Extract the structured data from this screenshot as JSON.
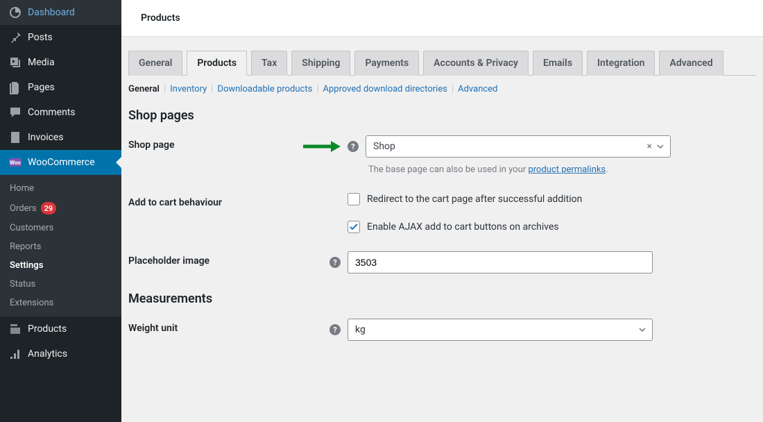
{
  "sidebar": {
    "items": [
      {
        "label": "Dashboard"
      },
      {
        "label": "Posts"
      },
      {
        "label": "Media"
      },
      {
        "label": "Pages"
      },
      {
        "label": "Comments"
      },
      {
        "label": "Invoices"
      },
      {
        "label": "WooCommerce"
      },
      {
        "label": "Products"
      },
      {
        "label": "Analytics"
      }
    ],
    "woocommerce_submenu": [
      {
        "label": "Home"
      },
      {
        "label": "Orders",
        "badge": "29"
      },
      {
        "label": "Customers"
      },
      {
        "label": "Reports"
      },
      {
        "label": "Settings"
      },
      {
        "label": "Status"
      },
      {
        "label": "Extensions"
      }
    ]
  },
  "page": {
    "title": "Products"
  },
  "tabs": [
    "General",
    "Products",
    "Tax",
    "Shipping",
    "Payments",
    "Accounts & Privacy",
    "Emails",
    "Integration",
    "Advanced"
  ],
  "subtabs": [
    "General",
    "Inventory",
    "Downloadable products",
    "Approved download directories",
    "Advanced"
  ],
  "sections": {
    "shop_pages": {
      "heading": "Shop pages",
      "shop_page": {
        "label": "Shop page",
        "value": "Shop",
        "hint_prefix": "The base page can also be used in your ",
        "hint_link": "product permalinks",
        "hint_suffix": "."
      },
      "add_to_cart": {
        "label": "Add to cart behaviour",
        "redirect_label": "Redirect to the cart page after successful addition",
        "ajax_label": "Enable AJAX add to cart buttons on archives"
      },
      "placeholder_image": {
        "label": "Placeholder image",
        "value": "3503"
      }
    },
    "measurements": {
      "heading": "Measurements",
      "weight_unit": {
        "label": "Weight unit",
        "value": "kg"
      }
    }
  }
}
